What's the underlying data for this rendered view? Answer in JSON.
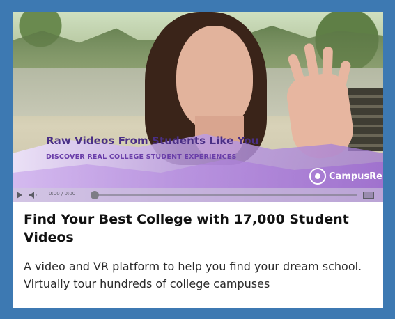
{
  "ad": {
    "video": {
      "headline": "Raw Videos From Students Like You",
      "subline": "DISCOVER REAL COLLEGE STUDENT EXPERIENCES",
      "brand": "CampusRe",
      "time": "0:00 / 0:00"
    },
    "title": "Find Your Best College with 17,000 Student Videos",
    "description": "A video and VR platform to help you find your dream school. Virtually tour hundreds of college campuses"
  },
  "colors": {
    "frame": "#3d79b2",
    "headline": "#4a2f86",
    "subline": "#6a3ea9"
  },
  "icons": [
    "play-icon",
    "volume-icon",
    "fullscreen-icon",
    "campusreel-logo-icon"
  ]
}
